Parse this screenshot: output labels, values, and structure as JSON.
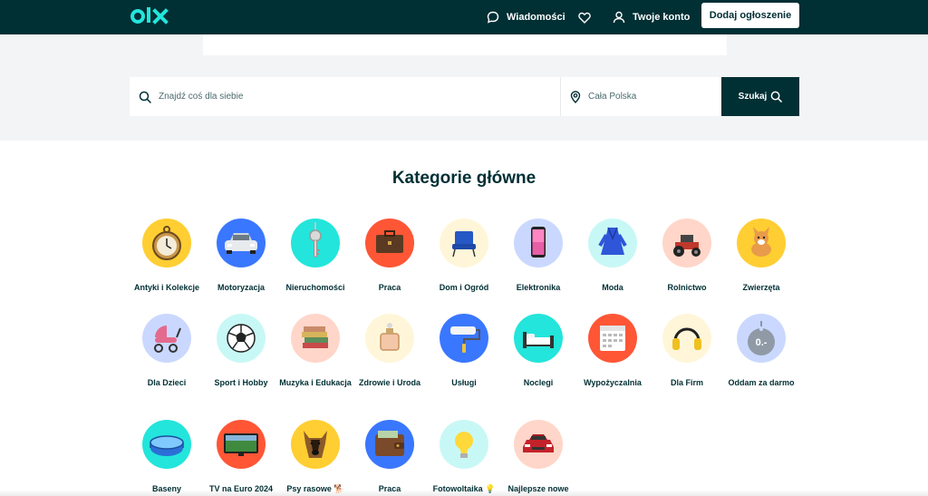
{
  "header": {
    "logo_text": "olx",
    "messages_label": "Wiadomości",
    "account_label": "Twoje konto",
    "add_listing_label": "Dodaj ogłoszenie"
  },
  "search": {
    "query_placeholder": "Znajdź coś dla siebie",
    "location_placeholder": "Cała Polska",
    "button_label": "Szukaj"
  },
  "categories_title": "Kategorie główne",
  "categories": [
    {
      "label": "Antyki i Kolekcje",
      "color": "#ffce32",
      "icon": "pocket-watch-icon"
    },
    {
      "label": "Motoryzacja",
      "color": "#3a77ff",
      "icon": "car-icon"
    },
    {
      "label": "Nieruchomości",
      "color": "#23e5db",
      "icon": "key-icon"
    },
    {
      "label": "Praca",
      "color": "#ff5636",
      "icon": "briefcase-icon"
    },
    {
      "label": "Dom i Ogród",
      "color": "#fff6d9",
      "icon": "armchair-icon"
    },
    {
      "label": "Elektronika",
      "color": "#cad8ff",
      "icon": "smartphone-icon"
    },
    {
      "label": "Moda",
      "color": "#c8f8f6",
      "icon": "dress-icon"
    },
    {
      "label": "Rolnictwo",
      "color": "#ffd6c9",
      "icon": "tractor-icon"
    },
    {
      "label": "Zwierzęta",
      "color": "#ffce32",
      "icon": "dog-icon"
    },
    {
      "label": "Dla Dzieci",
      "color": "#cad8ff",
      "icon": "stroller-icon"
    },
    {
      "label": "Sport i Hobby",
      "color": "#c8f8f6",
      "icon": "football-icon"
    },
    {
      "label": "Muzyka i Edukacja",
      "color": "#ffd6c9",
      "icon": "books-icon"
    },
    {
      "label": "Zdrowie i Uroda",
      "color": "#fff6d9",
      "icon": "perfume-icon"
    },
    {
      "label": "Usługi",
      "color": "#3a77ff",
      "icon": "paint-roller-icon"
    },
    {
      "label": "Noclegi",
      "color": "#23e5db",
      "icon": "bed-icon"
    },
    {
      "label": "Wypożyczalnia",
      "color": "#ff5636",
      "icon": "calendar-icon"
    },
    {
      "label": "Dla Firm",
      "color": "#fff6d9",
      "icon": "headphones-icon"
    },
    {
      "label": "Oddam za darmo",
      "color": "#cad8ff",
      "icon": "price-tag-icon",
      "tag_text": "0.-"
    },
    {
      "label": "Baseny",
      "color": "#23e5db",
      "icon": "pool-icon"
    },
    {
      "label": "TV na Euro 2024",
      "color": "#ff5636",
      "icon": "tv-icon"
    },
    {
      "label": "Psy rasowe 🐕",
      "color": "#ffce32",
      "icon": "shepherd-dog-icon"
    },
    {
      "label": "Praca",
      "color": "#3a77ff",
      "icon": "wallet-icon"
    },
    {
      "label": "Fotowoltaika 💡",
      "color": "#c8f8f6",
      "icon": "light-bulb-icon"
    },
    {
      "label": "Najlepsze nowe",
      "color": "#ffd6c9",
      "icon": "new-car-icon"
    }
  ]
}
